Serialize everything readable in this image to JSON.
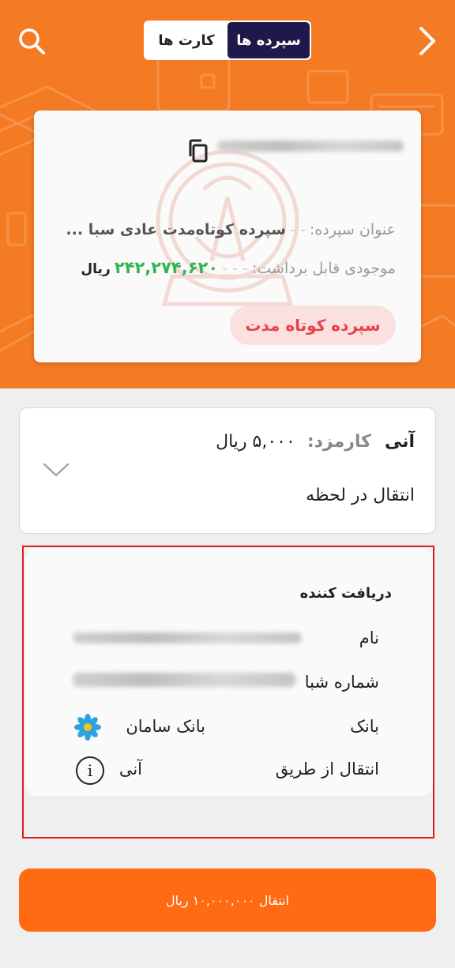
{
  "header": {
    "tabs": [
      {
        "label": "سپرده ها",
        "selected": true
      },
      {
        "label": "کارت ها",
        "selected": false
      }
    ],
    "icons": {
      "search": "search-icon",
      "back": "chevron-right-icon"
    },
    "accent_color": "#f47a24"
  },
  "account": {
    "title_label": "عنوان سپرده:",
    "title_value": "سپرده کوتاه‌مدت عادی سبا ...",
    "balance_label": "موجودی قابل برداشت:",
    "balance_value": "۲۴۲,۲۷۴,۶۲۰",
    "balance_currency": "ریال",
    "badge": "سپرده کوتاه مدت"
  },
  "transfer_method": {
    "name": "آنی",
    "fee_label": "کارمزد:",
    "fee_value": "۵,۰۰۰ ریال",
    "description": "انتقال در لحظه"
  },
  "receiver": {
    "title": "دریافت کننده",
    "rows": [
      {
        "label": "نام"
      },
      {
        "label": "شماره شبا"
      },
      {
        "label": "بانک",
        "value": "بانک سامان"
      },
      {
        "label": "انتقال از طریق",
        "value": "آنی"
      }
    ]
  },
  "submit": {
    "label": "انتقال ۱۰,۰۰۰,۰۰۰ ریال"
  },
  "colors": {
    "primary_button": "#ff6a13",
    "balance": "#2fb84f",
    "badge_text": "#e8434a",
    "selected_tab": "#20184a"
  }
}
